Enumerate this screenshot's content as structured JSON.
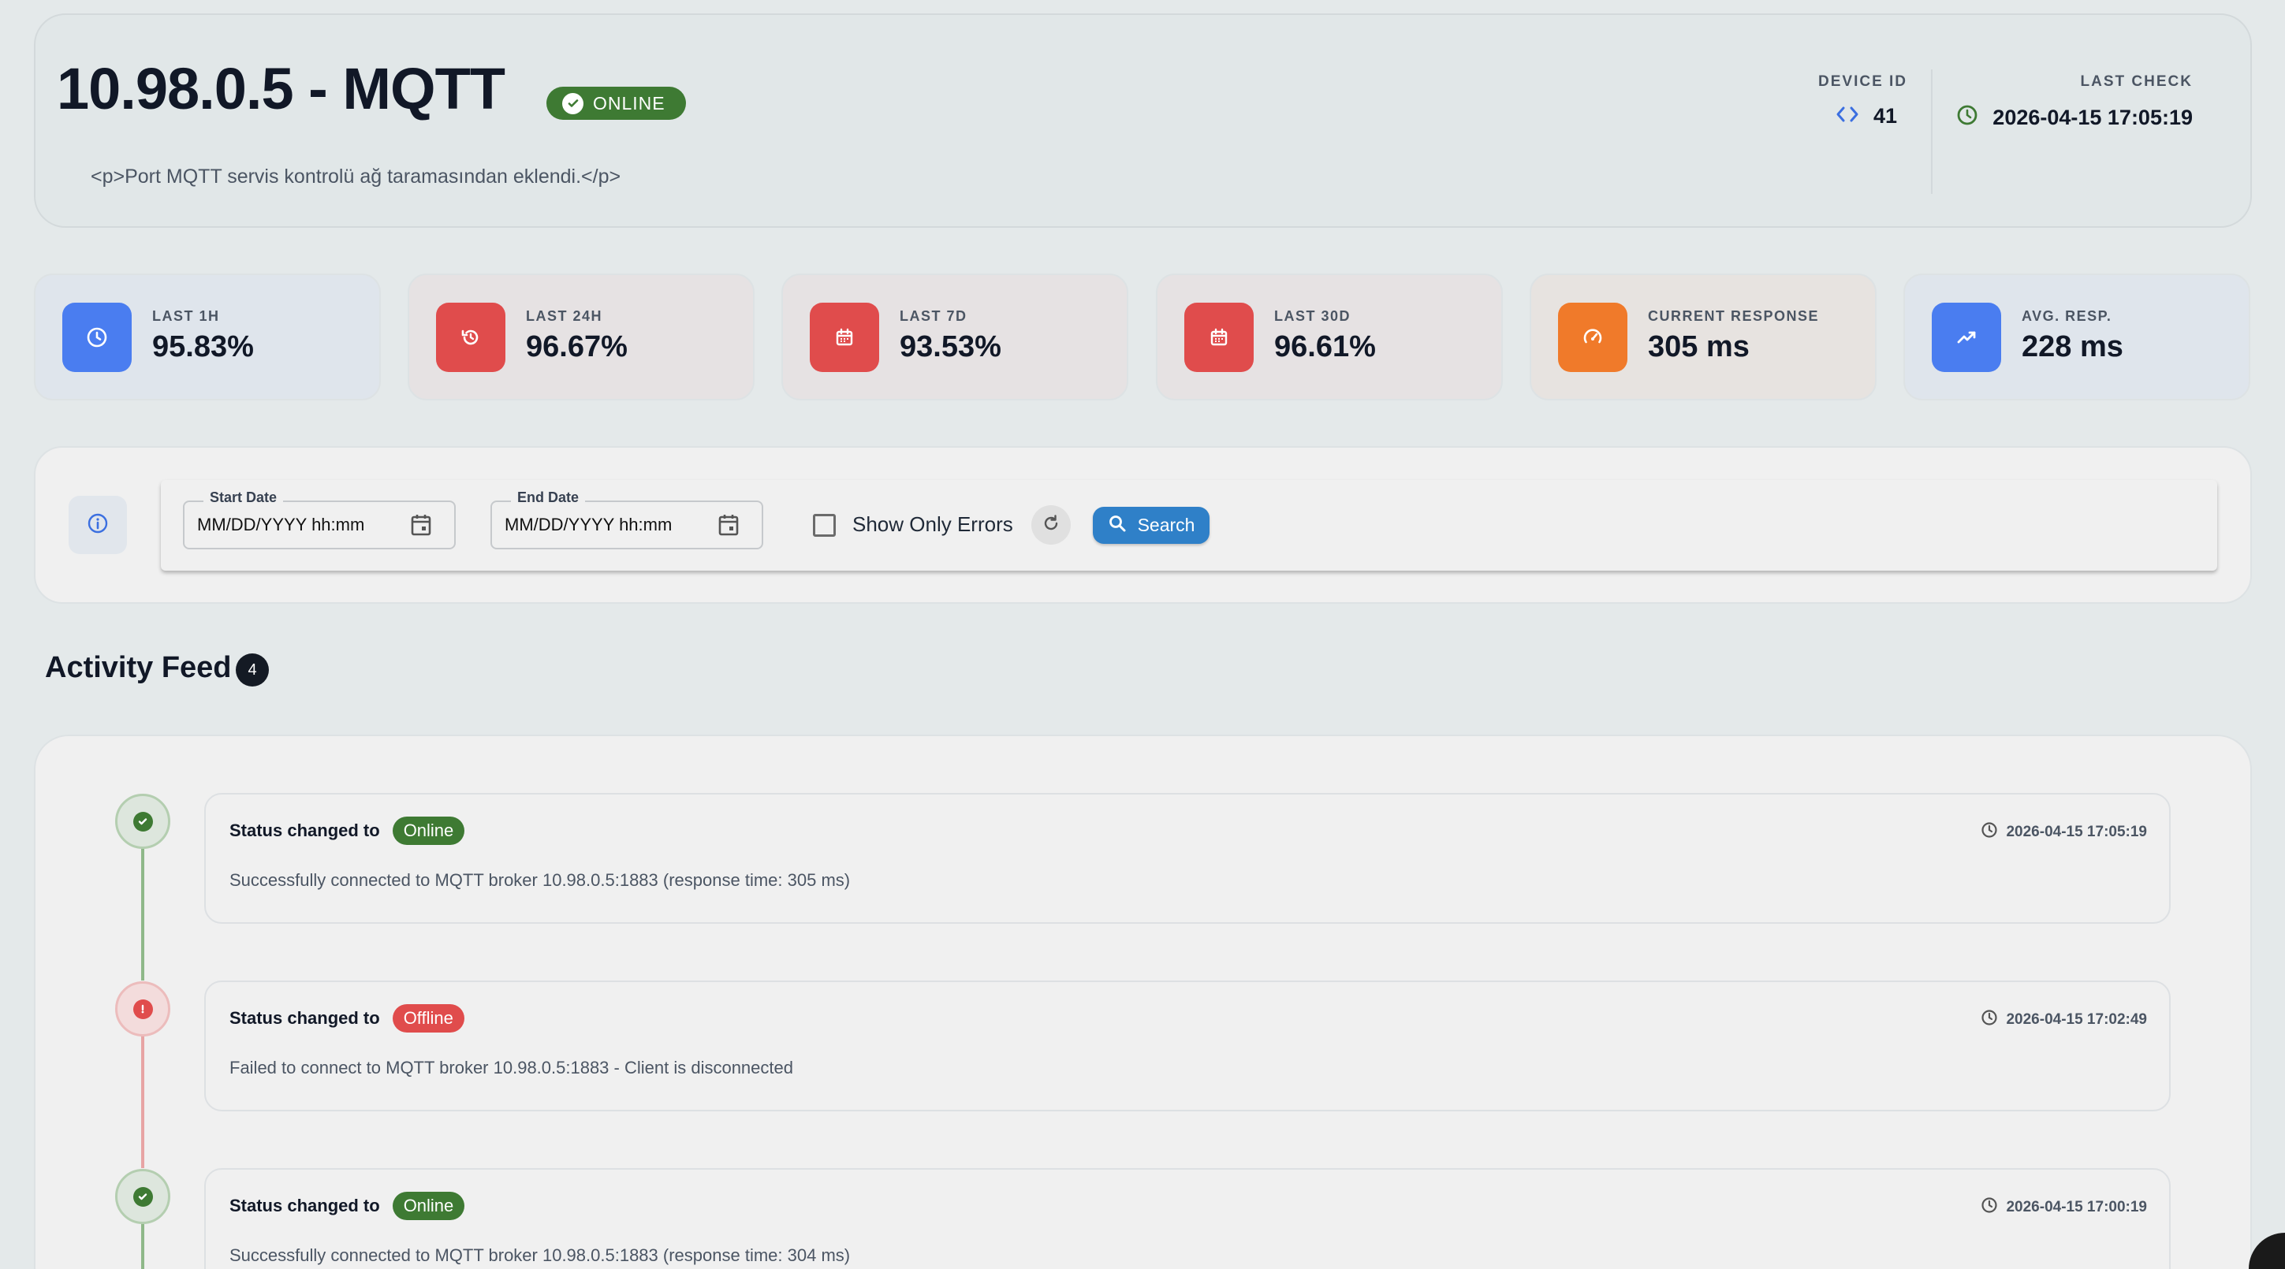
{
  "header": {
    "title": "10.98.0.5 - MQTT",
    "status_badge": "ONLINE",
    "description": "<p>Port MQTT servis kontrolü ağ taramasından eklendi.</p>",
    "device_id_label": "DEVICE ID",
    "device_id_value": "41",
    "last_check_label": "LAST CHECK",
    "last_check_value": "2026-04-15 17:05:19"
  },
  "stats": [
    {
      "label": "LAST 1H",
      "value": "95.83%",
      "icon": "clock-icon",
      "color": "#4a7df0"
    },
    {
      "label": "LAST 24H",
      "value": "96.67%",
      "icon": "history-icon",
      "color": "#e04c4c"
    },
    {
      "label": "LAST 7D",
      "value": "93.53%",
      "icon": "calendar-icon",
      "color": "#e04c4c"
    },
    {
      "label": "LAST 30D",
      "value": "96.61%",
      "icon": "calendar-icon",
      "color": "#e04c4c"
    },
    {
      "label": "CURRENT RESPONSE",
      "value": "305 ms",
      "icon": "speedometer-icon",
      "color": "#f07a2a"
    },
    {
      "label": "AVG. RESP.",
      "value": "228 ms",
      "icon": "trending-up-icon",
      "color": "#4a7df0"
    }
  ],
  "filters": {
    "start_label": "Start Date",
    "start_value": "MM/DD/YYYY hh:mm",
    "end_label": "End Date",
    "end_value": "MM/DD/YYYY hh:mm",
    "errors_only_label": "Show Only Errors",
    "search_label": "Search"
  },
  "feed": {
    "title": "Activity Feed",
    "count": "4",
    "events": [
      {
        "prefix": "Status changed to",
        "status": "Online",
        "time": "2026-04-15 17:05:19",
        "message": "Successfully connected to MQTT broker 10.98.0.5:1883 (response time: 305 ms)"
      },
      {
        "prefix": "Status changed to",
        "status": "Offline",
        "time": "2026-04-15 17:02:49",
        "message": "Failed to connect to MQTT broker 10.98.0.5:1883 - Client is disconnected"
      },
      {
        "prefix": "Status changed to",
        "status": "Online",
        "time": "2026-04-15 17:00:19",
        "message": "Successfully connected to MQTT broker 10.98.0.5:1883 (response time: 304 ms)"
      }
    ]
  },
  "colors": {
    "online": "#3e7a33",
    "offline": "#e04c4c",
    "accent": "#2f80c8"
  }
}
